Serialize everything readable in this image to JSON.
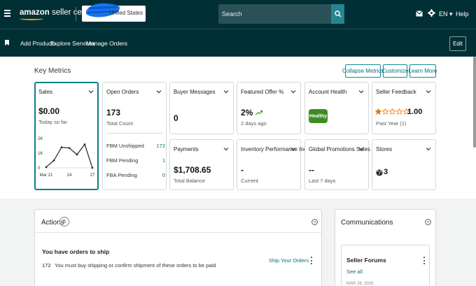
{
  "header": {
    "logo": {
      "brand": "amazon",
      "suffix": "seller central"
    },
    "store_country": "United States",
    "search_placeholder": "Search",
    "language": "EN",
    "help": "Help"
  },
  "nav": {
    "links": [
      "Add Products",
      "Explore Services",
      "Manage Orders"
    ],
    "edit_label": "Edit"
  },
  "key_metrics": {
    "title": "Key Metrics",
    "buttons": [
      "Collapse Metrics",
      "Customize",
      "Learn More"
    ],
    "sales": {
      "title": "Sales",
      "value": "$0.00",
      "sub": "Today so far",
      "chart_data": {
        "type": "line",
        "x": [
          "Mar 21",
          "22",
          "23",
          "24",
          "25",
          "26",
          "27"
        ],
        "values": [
          50,
          500,
          1400,
          1350,
          900,
          1600,
          0
        ],
        "yticks": [
          "2K",
          "1K",
          "0"
        ],
        "xticks": [
          "Mar 21",
          "24",
          "27"
        ],
        "ylim": [
          0,
          2000
        ]
      }
    },
    "open_orders": {
      "title": "Open Orders",
      "value": "173",
      "sub": "Total Count",
      "rows": [
        {
          "label": "FBM Unshipped",
          "value": "172"
        },
        {
          "label": "FBM Pending",
          "value": "1"
        },
        {
          "label": "FBA Pending",
          "value": "0"
        }
      ]
    },
    "buyer_messages": {
      "title": "Buyer Messages",
      "value": "0"
    },
    "featured_offer": {
      "title": "Featured Offer %",
      "value": "2%",
      "sub": "2 days ago"
    },
    "account_health": {
      "title": "Account Health",
      "badge": "Healthy"
    },
    "seller_feedback": {
      "title": "Seller Feedback",
      "rating": "1.00",
      "stars_filled": 1,
      "stars_total": 5,
      "sub": "Past Year (1)"
    },
    "payments": {
      "title": "Payments",
      "value": "$1,708.65",
      "sub": "Total Balance"
    },
    "inventory": {
      "title": "Inventory Performance Index",
      "value": "-",
      "sub": "Current"
    },
    "global_promotions": {
      "title": "Global Promotions Sales",
      "value": "--",
      "sub": "Last 7 days"
    },
    "stores": {
      "title": "Stores",
      "value": "3"
    }
  },
  "actions": {
    "title": "Actions",
    "count": "5",
    "heading": "You have orders to ship",
    "orders_count": "172",
    "orders_desc": "You must buy shipping or confirm shipment of these orders to be paid",
    "link": "Ship Your Orders"
  },
  "communications": {
    "title": "Communications",
    "forum_title": "Seller Forums",
    "see_all": "See all",
    "forum_date": "MAR 26, 2025"
  },
  "colors": {
    "header_bg": "#002f36",
    "accent_teal": "#0b7c8c",
    "healthy_green": "#3d8c22",
    "star_orange": "#e77600"
  }
}
